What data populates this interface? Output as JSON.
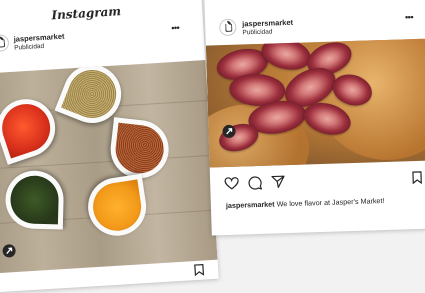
{
  "post1": {
    "brand": "Instagram",
    "username": "jaspersmarket",
    "sponsored": "Publicidad",
    "more": "•••"
  },
  "post2": {
    "username": "jaspersmarket",
    "sponsored": "Publicidad",
    "more": "•••",
    "caption_user": "jaspersmarket",
    "caption_text": "We love flavor at Jasper's Market!"
  },
  "icons": {
    "like": "heart-icon",
    "comment": "comment-icon",
    "share": "share-icon",
    "save": "bookmark-icon",
    "expand": "expand-icon"
  },
  "colors": {
    "paprika": "#d8301c",
    "seeds": "#b39a5c",
    "pepper": "#a0522d",
    "herbs": "#2f4a1f",
    "turmeric": "#f39a1a"
  }
}
